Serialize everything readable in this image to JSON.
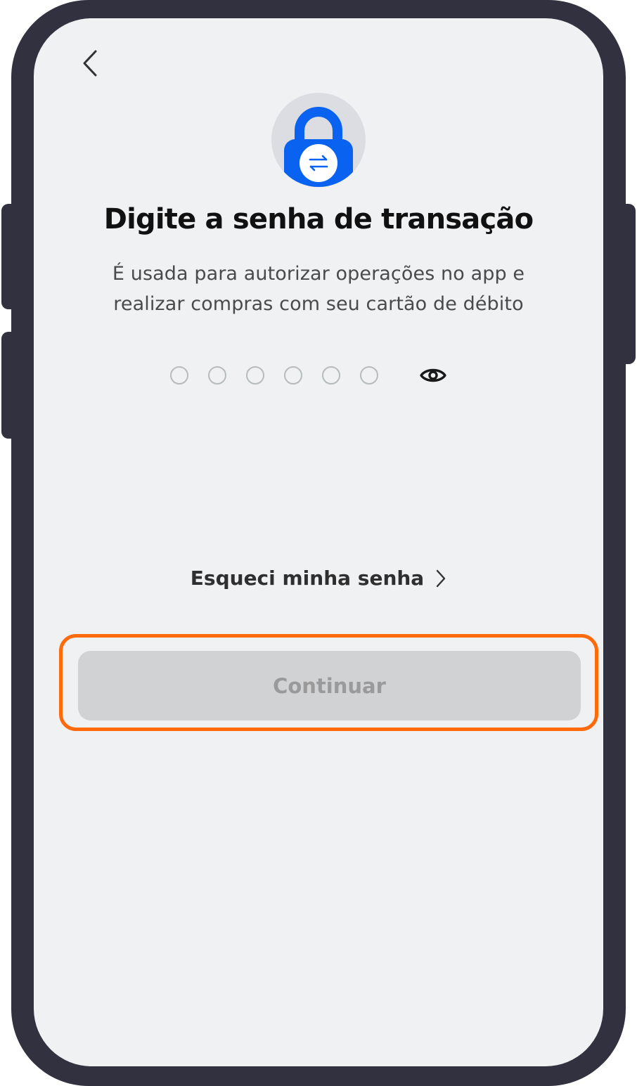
{
  "header": {
    "back_icon": "chevron-left-icon"
  },
  "hero": {
    "icon": "lock-transfer-icon",
    "icon_color": "#0a63f0",
    "title": "Digite a senha de transação",
    "subtitle": "É usada para autorizar operações no app e realizar compras com seu cartão de débito"
  },
  "pin": {
    "digits_total": 6,
    "digits_entered": 0,
    "visibility_icon": "eye-icon"
  },
  "links": {
    "forgot_password_label": "Esqueci minha senha",
    "forgot_password_icon": "chevron-right-icon"
  },
  "actions": {
    "continue_label": "Continuar",
    "continue_enabled": false,
    "highlight_color": "#ff6a0a"
  },
  "colors": {
    "background": "#f0f1f3",
    "device_frame": "#32313f",
    "button_disabled_bg": "#d1d2d4",
    "button_disabled_text": "#9a9a9a"
  }
}
